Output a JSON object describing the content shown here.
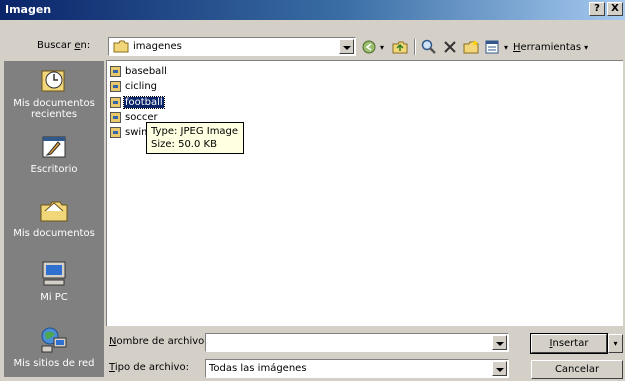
{
  "dialog": {
    "title": "Imagen",
    "help_label": "?",
    "close_label": "X"
  },
  "lookin": {
    "label_pre": "Buscar ",
    "label_key": "e",
    "label_post": "n:",
    "value": "imagenes"
  },
  "toolbar": {
    "tools_key": "H",
    "tools_rest": "erramientas",
    "tools_arrow": "▾",
    "views_arrow": "▾",
    "back_arrow": "▾"
  },
  "places": [
    {
      "label": "Mis documentos recientes",
      "icon": "recent-documents-icon"
    },
    {
      "label": "Escritorio",
      "icon": "desktop-icon"
    },
    {
      "label": "Mis documentos",
      "icon": "my-documents-icon"
    },
    {
      "label": "Mi PC",
      "icon": "my-computer-icon"
    },
    {
      "label": "Mis sitios de red",
      "icon": "network-places-icon"
    }
  ],
  "files": [
    {
      "name": "baseball",
      "selected": false
    },
    {
      "name": "cicling",
      "selected": false
    },
    {
      "name": "football",
      "selected": true
    },
    {
      "name": "soccer",
      "selected": false
    },
    {
      "name": "swim",
      "selected": false
    }
  ],
  "tooltip": {
    "type_line": "Type: JPEG Image",
    "size_line": "Size: 50.0 KB"
  },
  "filename": {
    "label_key": "N",
    "label_rest": "ombre de archivo:",
    "value": ""
  },
  "filetype": {
    "label_key": "T",
    "label_rest": "ipo de archivo:",
    "value": "Todas las imágenes"
  },
  "buttons": {
    "insert_key": "I",
    "insert_rest": "nsertar",
    "insert_arrow": "▾",
    "cancel": "Cancelar"
  },
  "colors": {
    "title_bar": "#0a246a",
    "places_bar": "#808080",
    "selection": "#0a246a",
    "tooltip_bg": "#ffffe1"
  }
}
